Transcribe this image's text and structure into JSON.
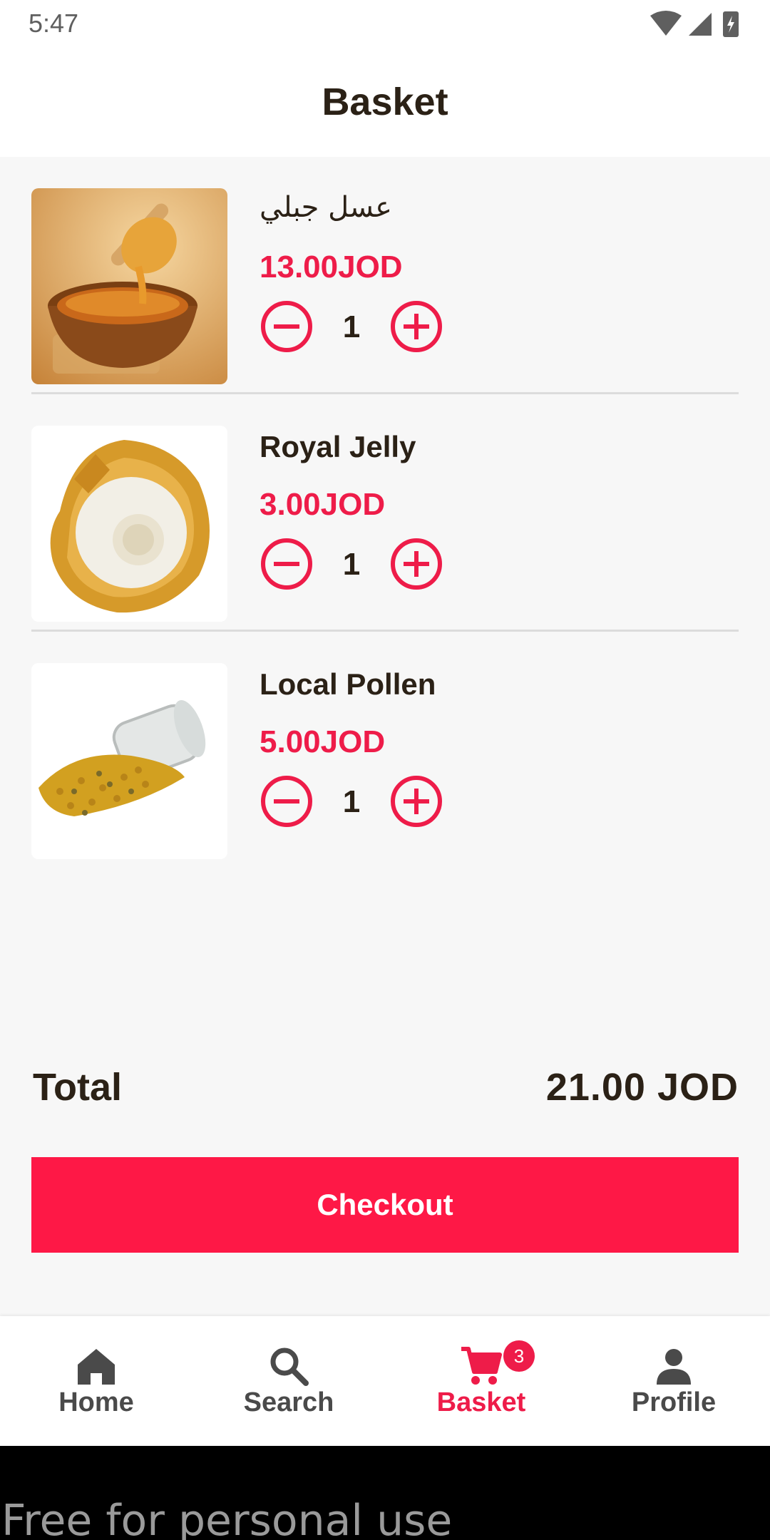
{
  "status_bar": {
    "time": "5:47"
  },
  "app_bar": {
    "title": "Basket"
  },
  "basket": {
    "items": [
      {
        "name": "عسل جبلي",
        "price": "13.00JOD",
        "quantity": "1",
        "image": "honey-bowl-image"
      },
      {
        "name": "Royal Jelly",
        "price": "3.00JOD",
        "quantity": "1",
        "image": "royal-jelly-image"
      },
      {
        "name": "Local Pollen",
        "price": "5.00JOD",
        "quantity": "1",
        "image": "pollen-jar-image"
      }
    ]
  },
  "summary": {
    "total_label": "Total",
    "total_value": "21.00 JOD"
  },
  "checkout": {
    "label": "Checkout"
  },
  "bottom_nav": {
    "items": [
      {
        "label": "Home",
        "icon": "home-icon"
      },
      {
        "label": "Search",
        "icon": "search-icon"
      },
      {
        "label": "Basket",
        "icon": "cart-icon",
        "badge": "3",
        "active": true
      },
      {
        "label": "Profile",
        "icon": "person-icon"
      }
    ]
  },
  "watermark": {
    "text": "Free for personal use"
  },
  "colors": {
    "accent": "#ee1c49",
    "button": "#fe1846",
    "text": "#2b2116",
    "background": "#f7f7f7"
  }
}
